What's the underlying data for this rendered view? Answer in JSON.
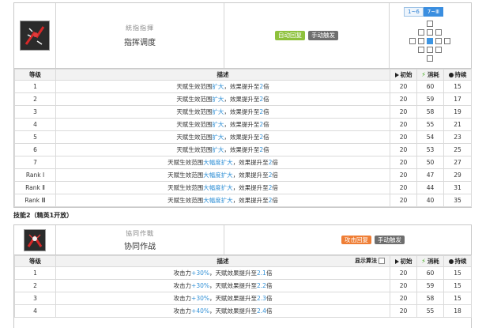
{
  "skill1": {
    "name_sub": "統指指揮",
    "name": "指挥调度",
    "tags": [
      "自动回复",
      "手动触发"
    ],
    "range_tabs": [
      "1~6",
      "7~Ⅲ"
    ],
    "headers": {
      "level": "等级",
      "desc": "描述",
      "init": "初始",
      "cost": "消耗",
      "duration": "持续"
    },
    "rows": [
      {
        "level": "1",
        "pre": "天赋生效范围",
        "hl": "扩大",
        "mid": "，效果提升至",
        "num": "2",
        "post": "倍",
        "init": "20",
        "cost": "60",
        "dur": "15"
      },
      {
        "level": "2",
        "pre": "天赋生效范围",
        "hl": "扩大",
        "mid": "，效果提升至",
        "num": "2",
        "post": "倍",
        "init": "20",
        "cost": "59",
        "dur": "17"
      },
      {
        "level": "3",
        "pre": "天赋生效范围",
        "hl": "扩大",
        "mid": "，效果提升至",
        "num": "2",
        "post": "倍",
        "init": "20",
        "cost": "58",
        "dur": "19"
      },
      {
        "level": "4",
        "pre": "天赋生效范围",
        "hl": "扩大",
        "mid": "，效果提升至",
        "num": "2",
        "post": "倍",
        "init": "20",
        "cost": "55",
        "dur": "21"
      },
      {
        "level": "5",
        "pre": "天赋生效范围",
        "hl": "扩大",
        "mid": "，效果提升至",
        "num": "2",
        "post": "倍",
        "init": "20",
        "cost": "54",
        "dur": "23"
      },
      {
        "level": "6",
        "pre": "天赋生效范围",
        "hl": "扩大",
        "mid": "，效果提升至",
        "num": "2",
        "post": "倍",
        "init": "20",
        "cost": "53",
        "dur": "25"
      },
      {
        "level": "7",
        "pre": "天赋生效范围",
        "hl": "大幅度扩大",
        "mid": "，效果提升至",
        "num": "2",
        "post": "倍",
        "init": "20",
        "cost": "50",
        "dur": "27"
      },
      {
        "level": "Rank Ⅰ",
        "pre": "天赋生效范围",
        "hl": "大幅度扩大",
        "mid": "，效果提升至",
        "num": "2",
        "post": "倍",
        "init": "20",
        "cost": "47",
        "dur": "29"
      },
      {
        "level": "Rank Ⅱ",
        "pre": "天赋生效范围",
        "hl": "大幅度扩大",
        "mid": "，效果提升至",
        "num": "2",
        "post": "倍",
        "init": "20",
        "cost": "44",
        "dur": "31"
      },
      {
        "level": "Rank Ⅲ",
        "pre": "天赋生效范围",
        "hl": "大幅度扩大",
        "mid": "，效果提升至",
        "num": "2",
        "post": "倍",
        "init": "20",
        "cost": "40",
        "dur": "35"
      }
    ]
  },
  "section2_title": "技能2（精英1开放）",
  "skill2": {
    "name_sub": "協同作戰",
    "name": "协同作战",
    "tags": [
      "攻击回复",
      "手动触发"
    ],
    "show_algorithm": "显示算法",
    "headers": {
      "level": "等级",
      "desc": "描述",
      "init": "初始",
      "cost": "消耗",
      "duration": "持续"
    },
    "rows": [
      {
        "level": "1",
        "pre": "攻击力",
        "hl": "+30%",
        "mid": "，天赋效果提升至",
        "num": "2.1",
        "post": "倍",
        "init": "20",
        "cost": "60",
        "dur": "15"
      },
      {
        "level": "2",
        "pre": "攻击力",
        "hl": "+30%",
        "mid": "，天赋效果提升至",
        "num": "2.2",
        "post": "倍",
        "init": "20",
        "cost": "59",
        "dur": "15"
      },
      {
        "level": "3",
        "pre": "攻击力",
        "hl": "+30%",
        "mid": "，天赋效果提升至",
        "num": "2.3",
        "post": "倍",
        "init": "20",
        "cost": "58",
        "dur": "15"
      },
      {
        "level": "4",
        "pre": "攻击力",
        "hl": "+40%",
        "mid": "，天赋效果提升至",
        "num": "2.4",
        "post": "倍",
        "init": "20",
        "cost": "55",
        "dur": "18"
      }
    ]
  },
  "colors": {
    "highlight": "#3190d6",
    "tag_green": "#8ec13c",
    "tag_gray": "#6e6e6e",
    "tag_orange": "#ef7e35",
    "range_blue": "#3d95e2"
  },
  "icons": {
    "skill1": "command-dispatch-icon",
    "skill2": "coordinated-combat-icon",
    "init": "play-icon",
    "cost": "lightning-icon",
    "duration": "clock-icon"
  }
}
